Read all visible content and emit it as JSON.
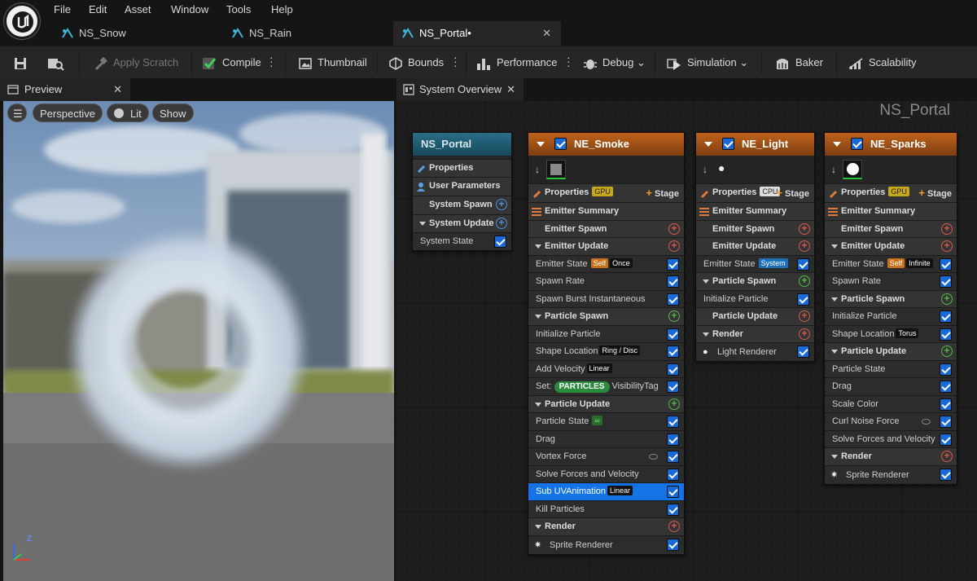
{
  "menu": [
    "File",
    "Edit",
    "Asset",
    "Window",
    "Tools",
    "Help"
  ],
  "tabs": [
    {
      "label": "NS_Snow"
    },
    {
      "label": "NS_Rain"
    },
    {
      "label": "NS_Portal•"
    }
  ],
  "tab_close": "✕",
  "toolbar": {
    "apply_scratch": "Apply Scratch",
    "compile": "Compile",
    "thumbnail": "Thumbnail",
    "bounds": "Bounds",
    "performance": "Performance",
    "debug": "Debug",
    "simulation": "Simulation",
    "baker": "Baker",
    "scalability": "Scalability"
  },
  "preview": {
    "tab": "Preview",
    "close": "✕",
    "perspective": "Perspective",
    "lit": "Lit",
    "show": "Show",
    "axis_z": "Z"
  },
  "overview": {
    "tab": "System Overview",
    "close": "✕",
    "title": "NS_Portal"
  },
  "system_node": {
    "title": "NS_Portal",
    "rows": [
      "Properties",
      "User Parameters",
      "System Spawn",
      "System Update",
      "System State"
    ]
  },
  "smoke": {
    "title": "NE_Smoke",
    "properties": "Properties",
    "gpu": "GPU",
    "stage": "Stage",
    "rows": [
      {
        "t": "sect0",
        "label": "Emitter Summary"
      },
      {
        "t": "sect",
        "label": "Emitter Spawn",
        "plus": "o"
      },
      {
        "t": "sect",
        "label": "Emitter Update",
        "plus": "o",
        "chev": true
      },
      {
        "t": "item",
        "label": "Emitter State",
        "b1": "Self",
        "b2": "Once"
      },
      {
        "t": "item",
        "label": "Spawn Rate"
      },
      {
        "t": "item",
        "label": "Spawn Burst Instantaneous"
      },
      {
        "t": "sect",
        "label": "Particle Spawn",
        "plus": "g",
        "chev": true
      },
      {
        "t": "item",
        "label": "Initialize Particle"
      },
      {
        "t": "item",
        "label": "Shape Location",
        "b2": "Ring / Disc"
      },
      {
        "t": "item",
        "label": "Add Velocity",
        "b2": "Linear"
      },
      {
        "t": "set",
        "label": "Set:",
        "pill": "PARTICLES",
        "after": "VisibilityTag"
      },
      {
        "t": "sect",
        "label": "Particle Update",
        "plus": "g",
        "chev": true
      },
      {
        "t": "item",
        "label": "Particle State",
        "inf": "∞"
      },
      {
        "t": "item",
        "label": "Drag"
      },
      {
        "t": "item",
        "label": "Vortex Force",
        "eye": true
      },
      {
        "t": "item",
        "label": "Solve Forces and Velocity"
      },
      {
        "t": "sel",
        "label": "Sub UVAnimation",
        "b2": "Linear"
      },
      {
        "t": "item",
        "label": "Kill Particles"
      },
      {
        "t": "sect",
        "label": "Render",
        "plus": "o",
        "chev": true
      },
      {
        "t": "rend",
        "label": "Sprite Renderer"
      }
    ]
  },
  "light": {
    "title": "NE_Light",
    "properties": "Properties",
    "cpu": "CPU",
    "stage": "Stage",
    "rows": [
      {
        "t": "sect0",
        "label": "Emitter Summary"
      },
      {
        "t": "sect",
        "label": "Emitter Spawn",
        "plus": "o"
      },
      {
        "t": "sect",
        "label": "Emitter Update",
        "plus": "o"
      },
      {
        "t": "item",
        "label": "Emitter State",
        "b3": "System"
      },
      {
        "t": "sect",
        "label": "Particle Spawn",
        "plus": "g",
        "chev": true
      },
      {
        "t": "item",
        "label": "Initialize Particle"
      },
      {
        "t": "sect",
        "label": "Particle Update",
        "plus": "o"
      },
      {
        "t": "sect",
        "label": "Render",
        "plus": "o",
        "chev": true
      },
      {
        "t": "rend",
        "label": "Light Renderer",
        "bulb": true
      }
    ]
  },
  "sparks": {
    "title": "NE_Sparks",
    "properties": "Properties",
    "gpu": "GPU",
    "stage": "Stage",
    "rows": [
      {
        "t": "sect0",
        "label": "Emitter Summary"
      },
      {
        "t": "sect",
        "label": "Emitter Spawn",
        "plus": "o"
      },
      {
        "t": "sect",
        "label": "Emitter Update",
        "plus": "o",
        "chev": true
      },
      {
        "t": "item",
        "label": "Emitter State",
        "b1": "Self",
        "b2": "Infinite"
      },
      {
        "t": "item",
        "label": "Spawn Rate"
      },
      {
        "t": "sect",
        "label": "Particle Spawn",
        "plus": "g",
        "chev": true
      },
      {
        "t": "item",
        "label": "Initialize Particle"
      },
      {
        "t": "item",
        "label": "Shape Location",
        "b2": "Torus"
      },
      {
        "t": "sect",
        "label": "Particle Update",
        "plus": "g",
        "chev": true
      },
      {
        "t": "item",
        "label": "Particle State"
      },
      {
        "t": "item",
        "label": "Drag"
      },
      {
        "t": "item",
        "label": "Scale Color"
      },
      {
        "t": "item",
        "label": "Curl Noise Force",
        "eye": true
      },
      {
        "t": "item",
        "label": "Solve Forces and Velocity"
      },
      {
        "t": "sect",
        "label": "Render",
        "plus": "o",
        "chev": true
      },
      {
        "t": "rend",
        "label": "Sprite Renderer"
      }
    ]
  }
}
